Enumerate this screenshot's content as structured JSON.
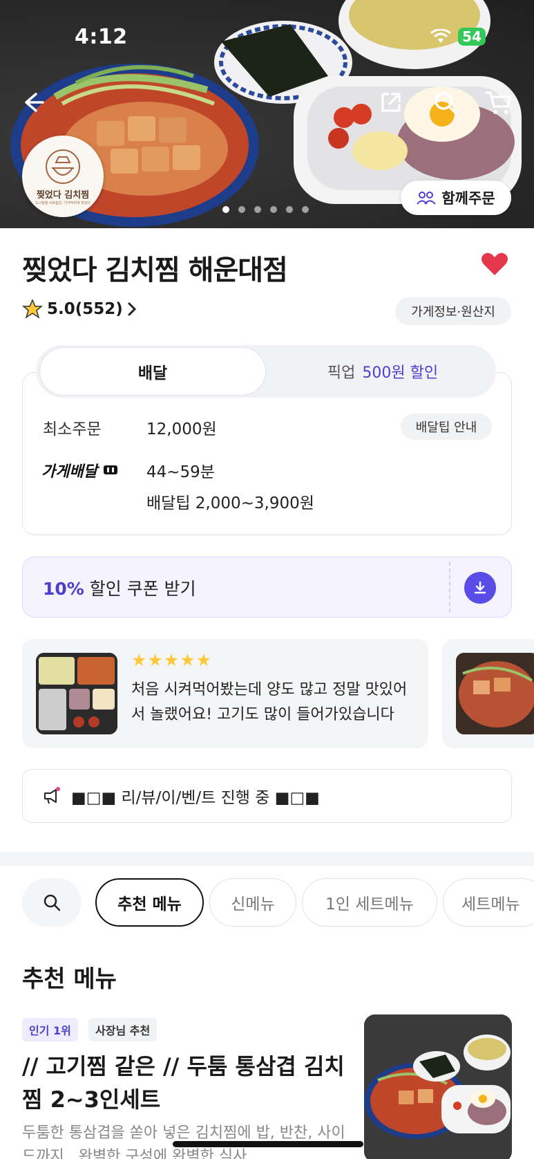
{
  "status_bar": {
    "time": "4:12",
    "battery": "54"
  },
  "hero": {
    "logo_text": "찢었다 김치찜",
    "logo_sub": "도니맘을 사로잡은, 기가막히게 맛있다",
    "group_order_label": "함께주문",
    "slide_count": 6,
    "active_slide": 1
  },
  "store": {
    "name": "찢었다 김치찜 해운대점",
    "rating": "5.0(552)",
    "info_chip": "가게정보·원산지",
    "favorited": true
  },
  "order_tabs": {
    "delivery": "배달",
    "pickup": "픽업",
    "pickup_discount": "500원 할인"
  },
  "delivery_info": {
    "min_order_label": "최소주문",
    "min_order_value": "12,000원",
    "tip_guide": "배달팁 안내",
    "delivery_type": "가게배달",
    "time": "44~59분",
    "tip": "배달팁 2,000~3,900원"
  },
  "coupon": {
    "percent": "10%",
    "label": " 할인 쿠폰 받기"
  },
  "review": {
    "stars": "★★★★★",
    "text": "처음 시켜먹어봤는데 양도 많고 정말 맛있어서 놀랬어요! 고기도 많이 들어가있습니다"
  },
  "notice": {
    "text": "■□■ 리/뷰/이/벤/트 진행 중 ■□■"
  },
  "categories": [
    "추천 메뉴",
    "신메뉴",
    "1인 세트메뉴",
    "세트메뉴"
  ],
  "menu": {
    "heading": "추천 메뉴",
    "tag_popular": "인기 1위",
    "tag_owner": "사장님 추천",
    "title": "// 고기찜 같은 // 두툼 통삼겹 김치찜 2~3인세트",
    "description": "두툼한 통삼겹을 쏟아 넣은 김치찜에 밥, 반찬, 사이드까지.. 완벽한 구성에 완벽한 식사"
  },
  "colors": {
    "accent": "#4b3fcf",
    "heart": "#e5384c",
    "star": "#ffc83a"
  }
}
